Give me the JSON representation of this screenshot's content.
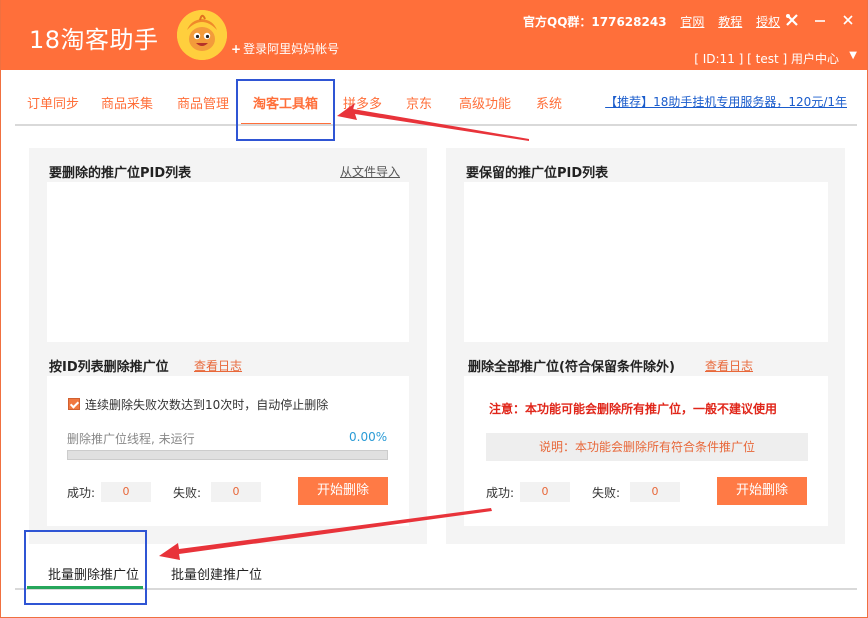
{
  "window": {
    "title": "18淘客助手",
    "login_link": "登录阿里妈妈帐号",
    "qq_label": "官方QQ群：177628243",
    "links": [
      "官网",
      "教程",
      "授权"
    ],
    "user_line": "[ ID:11 ] [ test ] 用户中心"
  },
  "nav": {
    "tabs": [
      "订单同步",
      "商品采集",
      "商品管理",
      "淘客工具箱",
      "拼多多",
      "京东",
      "高级功能",
      "系统"
    ],
    "active": "淘客工具箱",
    "promo": "【推荐】18助手挂机专用服务器，120元/1年"
  },
  "left_panel": {
    "pid_title": "要删除的推广位PID列表",
    "import_link": "从文件导入",
    "section_title": "按ID列表删除推广位",
    "log_link": "查看日志",
    "checkbox_label": "连续删除失败次数达到10次时，自动停止删除",
    "progress_label": "删除推广位线程, 未运行",
    "progress_percent": "0.00%",
    "progress_value": 0,
    "success_label": "成功:",
    "success_value": "0",
    "fail_label": "失败:",
    "fail_value": "0",
    "start_button": "开始删除"
  },
  "right_panel": {
    "pid_title": "要保留的推广位PID列表",
    "section_title": "删除全部推广位(符合保留条件除外)",
    "log_link": "查看日志",
    "warning": "注意：本功能可能会删除所有推广位，一般不建议使用",
    "description": "说明：本功能会删除所有符合条件推广位",
    "success_label": "成功:",
    "success_value": "0",
    "fail_label": "失败:",
    "fail_value": "0",
    "start_button": "开始删除"
  },
  "bottom_tabs": {
    "tabs": [
      "批量删除推广位",
      "批量创建推广位"
    ],
    "active": "批量删除推广位"
  },
  "colors": {
    "brand_orange": "#ff6f3a",
    "annotation_blue": "#2f55d4",
    "annotation_red": "#e8333a",
    "active_tab_green": "#26a65b"
  }
}
